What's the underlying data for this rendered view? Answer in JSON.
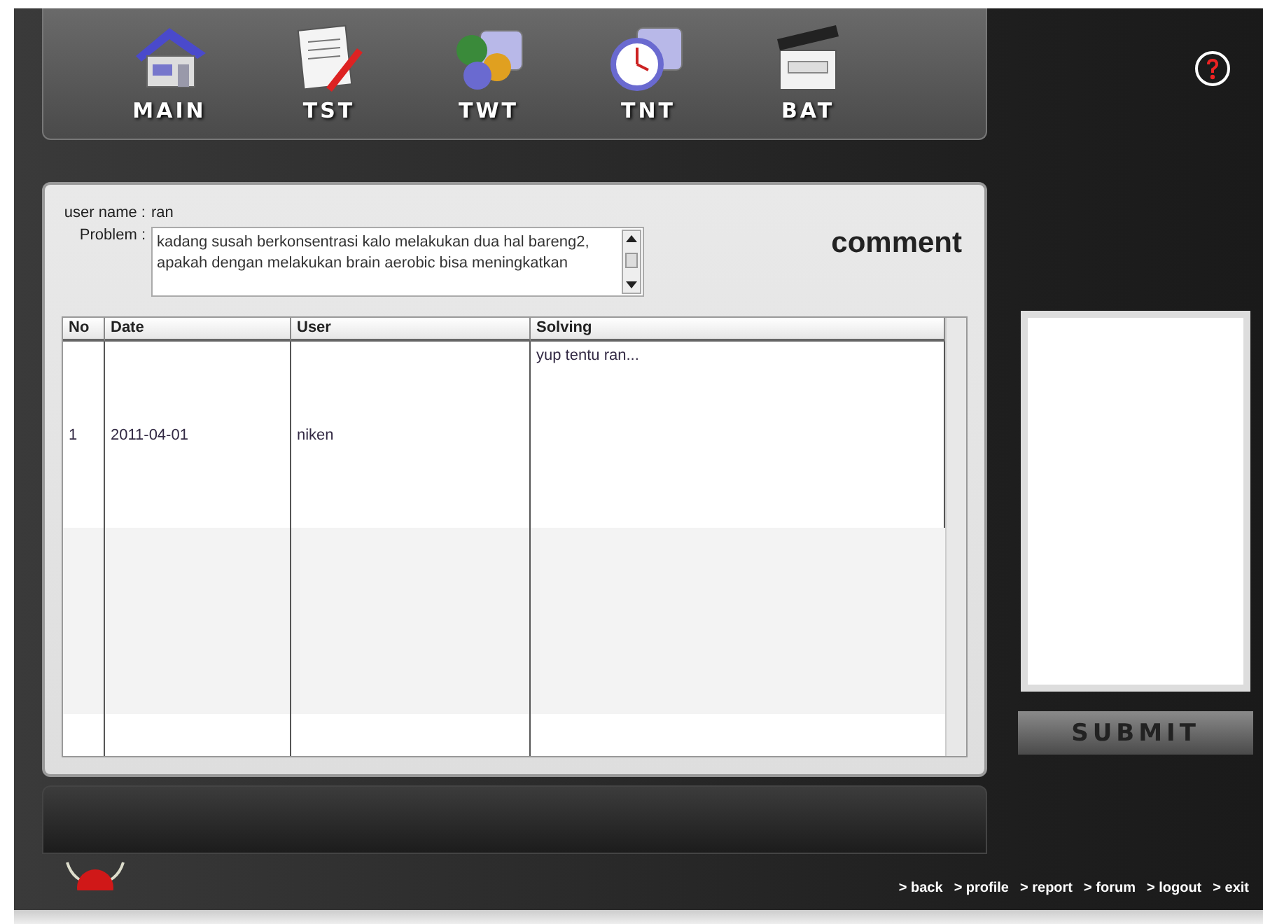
{
  "nav": [
    {
      "label": "MAIN"
    },
    {
      "label": "TST"
    },
    {
      "label": "TWT"
    },
    {
      "label": "TNT"
    },
    {
      "label": "BAT"
    }
  ],
  "form": {
    "user_name_label": "user name :",
    "user_name": "ran",
    "problem_label": "Problem :",
    "problem": "kadang susah berkonsentrasi kalo melakukan dua hal bareng2, apakah dengan melakukan brain aerobic bisa meningkatkan"
  },
  "heading": "comment",
  "table": {
    "columns": [
      "No",
      "Date",
      "User",
      "Solving"
    ],
    "rows": [
      {
        "no": "1",
        "date": "2011-04-01",
        "user": "niken",
        "solving": "yup tentu ran..."
      }
    ]
  },
  "submit": "SUBMIT",
  "footer_links": [
    "> back",
    "> profile",
    "> report",
    "> forum",
    "> logout",
    "> exit"
  ]
}
